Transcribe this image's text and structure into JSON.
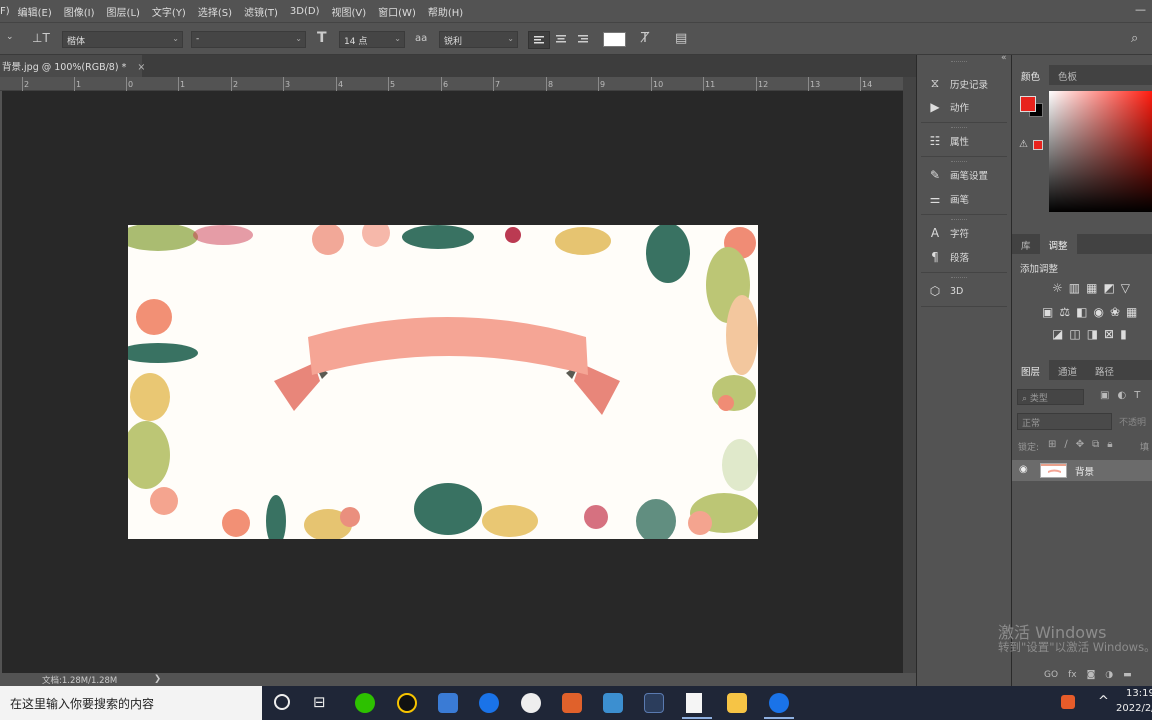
{
  "menubar": {
    "items": [
      "文件(F)",
      "编辑(E)",
      "图像(I)",
      "图层(L)",
      "文字(Y)",
      "选择(S)",
      "滤镜(T)",
      "3D(D)",
      "视图(V)",
      "窗口(W)",
      "帮助(H)"
    ],
    "visible_first": "F)",
    "minimize": "—"
  },
  "options": {
    "font_family": "楷体",
    "font_style": "-",
    "font_size": "14 点",
    "aa_glyph": "aa",
    "antialias": "锐利",
    "color_swatch": "#ffffff"
  },
  "document": {
    "tab_label": "背景.jpg @ 100%(RGB/8) *",
    "close": "×",
    "ruler_labels": [
      "2",
      "1",
      "0",
      "1",
      "2",
      "3",
      "4",
      "5",
      "6",
      "7",
      "8",
      "9",
      "10",
      "11",
      "12",
      "13",
      "14"
    ],
    "status": "文档:1.28M/1.28M",
    "status_arrow": "❯"
  },
  "dock": {
    "collapse": "«",
    "items": [
      {
        "label": "历史记录",
        "icon": "history-icon"
      },
      {
        "label": "动作",
        "icon": "play-icon"
      },
      {
        "label": "属性",
        "icon": "properties-icon"
      },
      {
        "label": "画笔设置",
        "icon": "brush-settings-icon"
      },
      {
        "label": "画笔",
        "icon": "brush-icon"
      },
      {
        "label": "字符",
        "icon": "character-icon"
      },
      {
        "label": "段落",
        "icon": "paragraph-icon"
      },
      {
        "label": "3D",
        "icon": "cube-icon"
      }
    ]
  },
  "panels": {
    "color_tabs": [
      "颜色",
      "色板"
    ],
    "fg_color": "#e8231d",
    "bg_color": "#000000",
    "lib_tabs": [
      "库",
      "调整"
    ],
    "add_adjust": "添加调整",
    "layers_tabs": [
      "图层",
      "通道",
      "路径"
    ],
    "layer_filter": "类型",
    "blend_mode": "正常",
    "opacity_label": "不透明",
    "lock_label": "锁定:",
    "fill_label": "填",
    "layer_name": "背景",
    "footer_link": "GO",
    "footer_fx": "fx"
  },
  "watermark": {
    "line1": "激活 Windows",
    "line2": "转到\"设置\"以激活 Windows。"
  },
  "taskbar": {
    "search_placeholder": "在这里输入你要搜索的内容",
    "time": "13:19",
    "date": "2022/2/",
    "chevron": "^"
  }
}
